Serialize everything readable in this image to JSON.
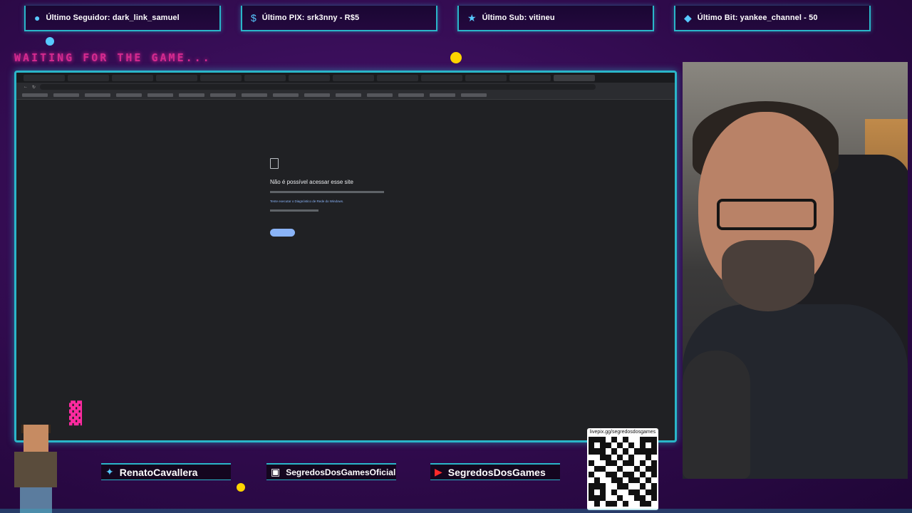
{
  "alerts": [
    {
      "icon": "user-icon",
      "text": "Último Seguidor: dark_link_samuel"
    },
    {
      "icon": "dollar-icon",
      "text": "Último PIX: srk3nny - R$5"
    },
    {
      "icon": "star-icon",
      "text": "Último Sub: vitineu"
    },
    {
      "icon": "diamond-icon",
      "text": "Último Bit: yankee_channel - 50"
    }
  ],
  "waiting_text": "WAITING FOR THE GAME...",
  "browser": {
    "error_title": "Não é possível acessar esse site",
    "error_link": "Tente executar o Diagnóstico de Rede do Windows."
  },
  "socials": [
    {
      "icon": "twitter-icon",
      "handle": "RenatoCavallera"
    },
    {
      "icon": "instagram-icon",
      "handle": "SegredosDosGamesOficial"
    },
    {
      "icon": "youtube-icon",
      "handle": "SegredosDosGames"
    }
  ],
  "qr": {
    "label": "livepix.gg/segredosdosgames"
  },
  "colors": {
    "accent": "#2ab6c9",
    "neon_pink": "#d42a8f",
    "background": "#3a0d5c"
  }
}
